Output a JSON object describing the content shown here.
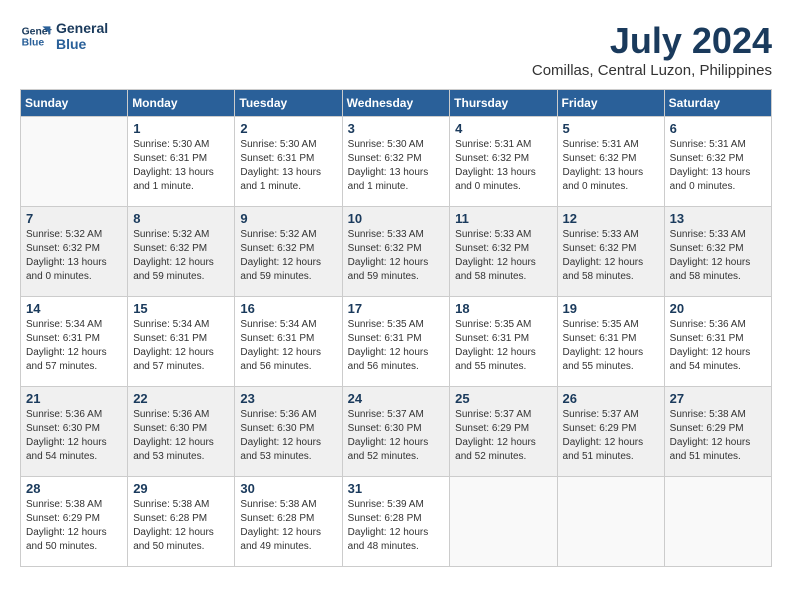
{
  "logo": {
    "line1": "General",
    "line2": "Blue"
  },
  "title": "July 2024",
  "subtitle": "Comillas, Central Luzon, Philippines",
  "days_header": [
    "Sunday",
    "Monday",
    "Tuesday",
    "Wednesday",
    "Thursday",
    "Friday",
    "Saturday"
  ],
  "weeks": [
    [
      {
        "num": "",
        "info": ""
      },
      {
        "num": "1",
        "info": "Sunrise: 5:30 AM\nSunset: 6:31 PM\nDaylight: 13 hours\nand 1 minute."
      },
      {
        "num": "2",
        "info": "Sunrise: 5:30 AM\nSunset: 6:31 PM\nDaylight: 13 hours\nand 1 minute."
      },
      {
        "num": "3",
        "info": "Sunrise: 5:30 AM\nSunset: 6:32 PM\nDaylight: 13 hours\nand 1 minute."
      },
      {
        "num": "4",
        "info": "Sunrise: 5:31 AM\nSunset: 6:32 PM\nDaylight: 13 hours\nand 0 minutes."
      },
      {
        "num": "5",
        "info": "Sunrise: 5:31 AM\nSunset: 6:32 PM\nDaylight: 13 hours\nand 0 minutes."
      },
      {
        "num": "6",
        "info": "Sunrise: 5:31 AM\nSunset: 6:32 PM\nDaylight: 13 hours\nand 0 minutes."
      }
    ],
    [
      {
        "num": "7",
        "info": "Sunrise: 5:32 AM\nSunset: 6:32 PM\nDaylight: 13 hours\nand 0 minutes."
      },
      {
        "num": "8",
        "info": "Sunrise: 5:32 AM\nSunset: 6:32 PM\nDaylight: 12 hours\nand 59 minutes."
      },
      {
        "num": "9",
        "info": "Sunrise: 5:32 AM\nSunset: 6:32 PM\nDaylight: 12 hours\nand 59 minutes."
      },
      {
        "num": "10",
        "info": "Sunrise: 5:33 AM\nSunset: 6:32 PM\nDaylight: 12 hours\nand 59 minutes."
      },
      {
        "num": "11",
        "info": "Sunrise: 5:33 AM\nSunset: 6:32 PM\nDaylight: 12 hours\nand 58 minutes."
      },
      {
        "num": "12",
        "info": "Sunrise: 5:33 AM\nSunset: 6:32 PM\nDaylight: 12 hours\nand 58 minutes."
      },
      {
        "num": "13",
        "info": "Sunrise: 5:33 AM\nSunset: 6:32 PM\nDaylight: 12 hours\nand 58 minutes."
      }
    ],
    [
      {
        "num": "14",
        "info": "Sunrise: 5:34 AM\nSunset: 6:31 PM\nDaylight: 12 hours\nand 57 minutes."
      },
      {
        "num": "15",
        "info": "Sunrise: 5:34 AM\nSunset: 6:31 PM\nDaylight: 12 hours\nand 57 minutes."
      },
      {
        "num": "16",
        "info": "Sunrise: 5:34 AM\nSunset: 6:31 PM\nDaylight: 12 hours\nand 56 minutes."
      },
      {
        "num": "17",
        "info": "Sunrise: 5:35 AM\nSunset: 6:31 PM\nDaylight: 12 hours\nand 56 minutes."
      },
      {
        "num": "18",
        "info": "Sunrise: 5:35 AM\nSunset: 6:31 PM\nDaylight: 12 hours\nand 55 minutes."
      },
      {
        "num": "19",
        "info": "Sunrise: 5:35 AM\nSunset: 6:31 PM\nDaylight: 12 hours\nand 55 minutes."
      },
      {
        "num": "20",
        "info": "Sunrise: 5:36 AM\nSunset: 6:31 PM\nDaylight: 12 hours\nand 54 minutes."
      }
    ],
    [
      {
        "num": "21",
        "info": "Sunrise: 5:36 AM\nSunset: 6:30 PM\nDaylight: 12 hours\nand 54 minutes."
      },
      {
        "num": "22",
        "info": "Sunrise: 5:36 AM\nSunset: 6:30 PM\nDaylight: 12 hours\nand 53 minutes."
      },
      {
        "num": "23",
        "info": "Sunrise: 5:36 AM\nSunset: 6:30 PM\nDaylight: 12 hours\nand 53 minutes."
      },
      {
        "num": "24",
        "info": "Sunrise: 5:37 AM\nSunset: 6:30 PM\nDaylight: 12 hours\nand 52 minutes."
      },
      {
        "num": "25",
        "info": "Sunrise: 5:37 AM\nSunset: 6:29 PM\nDaylight: 12 hours\nand 52 minutes."
      },
      {
        "num": "26",
        "info": "Sunrise: 5:37 AM\nSunset: 6:29 PM\nDaylight: 12 hours\nand 51 minutes."
      },
      {
        "num": "27",
        "info": "Sunrise: 5:38 AM\nSunset: 6:29 PM\nDaylight: 12 hours\nand 51 minutes."
      }
    ],
    [
      {
        "num": "28",
        "info": "Sunrise: 5:38 AM\nSunset: 6:29 PM\nDaylight: 12 hours\nand 50 minutes."
      },
      {
        "num": "29",
        "info": "Sunrise: 5:38 AM\nSunset: 6:28 PM\nDaylight: 12 hours\nand 50 minutes."
      },
      {
        "num": "30",
        "info": "Sunrise: 5:38 AM\nSunset: 6:28 PM\nDaylight: 12 hours\nand 49 minutes."
      },
      {
        "num": "31",
        "info": "Sunrise: 5:39 AM\nSunset: 6:28 PM\nDaylight: 12 hours\nand 48 minutes."
      },
      {
        "num": "",
        "info": ""
      },
      {
        "num": "",
        "info": ""
      },
      {
        "num": "",
        "info": ""
      }
    ]
  ]
}
